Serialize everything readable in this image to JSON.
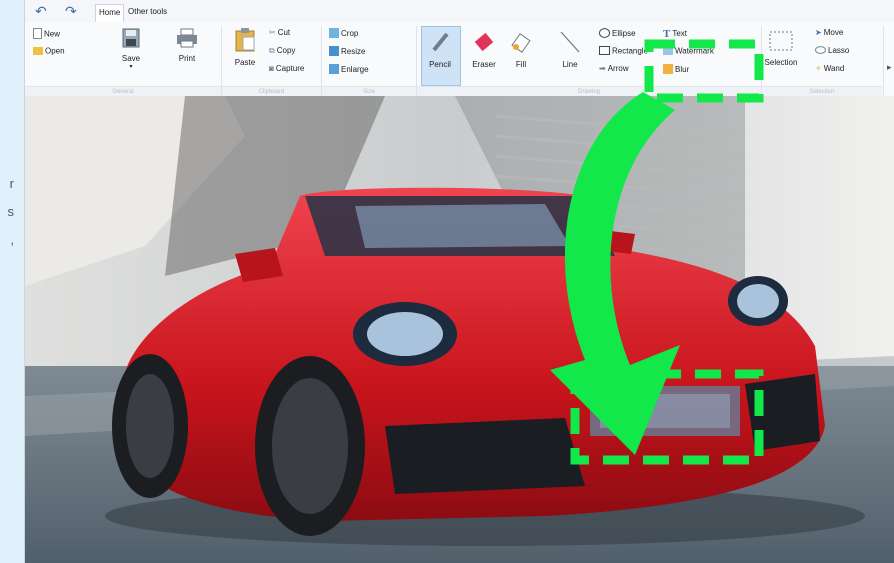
{
  "side_text": [
    "r",
    "s",
    ","
  ],
  "tabs": {
    "home": "Home",
    "other": "Other tools"
  },
  "file": {
    "new": "New",
    "open": "Open",
    "save": "Save",
    "print": "Print"
  },
  "clipboard": {
    "paste": "Paste",
    "cut": "Cut",
    "copy": "Copy",
    "capture": "Capture"
  },
  "size": {
    "crop": "Crop",
    "resize": "Resize",
    "enlarge": "Enlarge"
  },
  "drawing": {
    "pencil": "Pencil",
    "eraser": "Eraser",
    "fill": "Fill",
    "line": "Line",
    "ellipse": "Ellipse",
    "rectangle": "Rectangle",
    "arrow": "Arrow",
    "text": "Text",
    "watermark": "Watermark",
    "blur": "Blur"
  },
  "selection": {
    "selection": "Selection",
    "move": "Move",
    "lasso": "Lasso",
    "wand": "Wand"
  },
  "groups": {
    "general": "General",
    "clipboard": "Clipboard",
    "size": "Size",
    "drawing": "Drawing",
    "selection": "Selection"
  },
  "colors": {
    "highlight": "#12e84a",
    "car": "#d61a1f",
    "accent": "#2f7bd2"
  }
}
